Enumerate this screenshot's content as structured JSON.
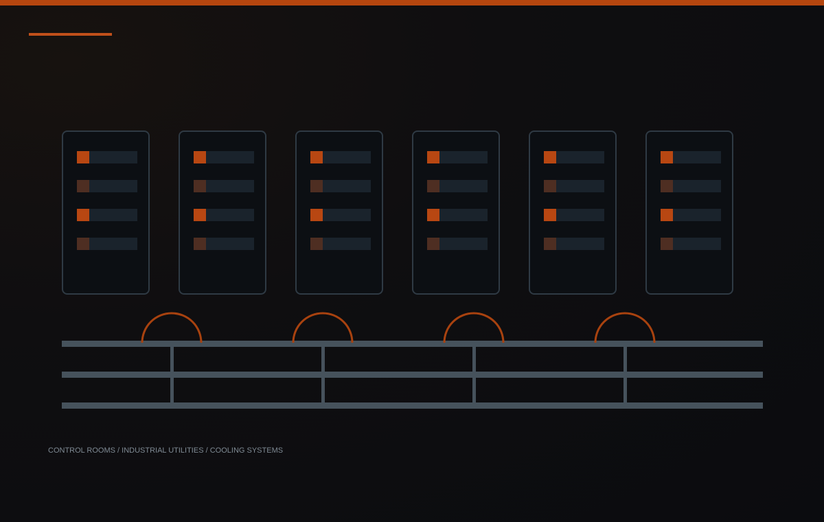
{
  "caption": "CONTROL ROOMS / INDUSTRIAL UTILITIES / COOLING SYSTEMS",
  "colors": {
    "accent": "#b5460f",
    "led_on": "#b84712",
    "led_off": "#4e2e22",
    "frame": "#2f3a44",
    "pipe": "#46525c"
  },
  "racks": [
    {
      "slots": [
        "on",
        "off",
        "on",
        "off"
      ]
    },
    {
      "slots": [
        "on",
        "off",
        "on",
        "off"
      ]
    },
    {
      "slots": [
        "on",
        "off",
        "on",
        "off"
      ]
    },
    {
      "slots": [
        "on",
        "off",
        "on",
        "off"
      ]
    },
    {
      "slots": [
        "on",
        "off",
        "on",
        "off"
      ]
    },
    {
      "slots": [
        "on",
        "off",
        "on",
        "off"
      ]
    }
  ]
}
